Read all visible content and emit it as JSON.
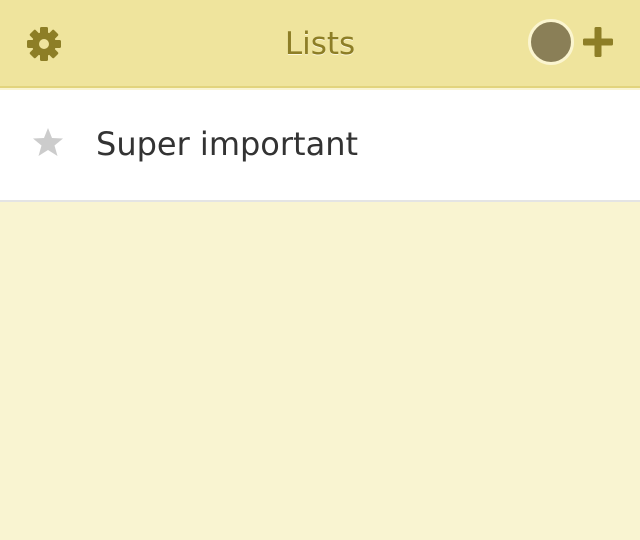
{
  "header": {
    "title": "Lists",
    "settings_icon": "gear-icon",
    "avatar_icon": "user-avatar",
    "add_icon": "plus-icon"
  },
  "lists": {
    "items": [
      {
        "label": "Super important",
        "starred": false,
        "star_icon": "star-icon"
      }
    ]
  },
  "colors": {
    "header_bg": "#efe49d",
    "header_accent": "#8d7e26",
    "page_bg": "#f9f4d1",
    "avatar": "#8a7f57",
    "star_inactive": "#cccccc",
    "text": "#333333"
  }
}
